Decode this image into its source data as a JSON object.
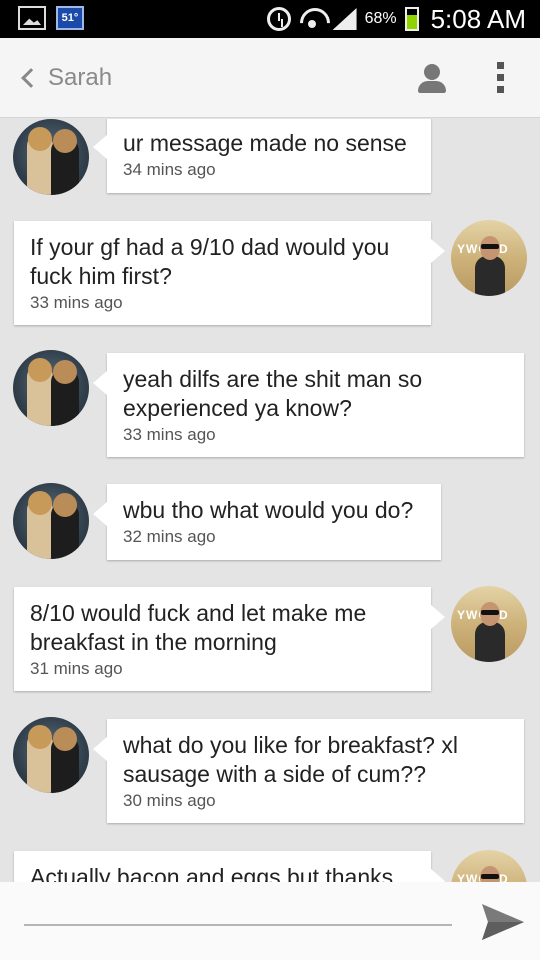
{
  "status_bar": {
    "temperature": "51°",
    "battery_percent": "68%",
    "battery_level": 0.68,
    "battery_color": "#8fd400",
    "time": "5:08 AM",
    "icons": [
      "gallery-icon",
      "weather-icon",
      "alarm-icon",
      "wifi-icon",
      "signal-icon",
      "battery-icon"
    ]
  },
  "header": {
    "title": "Sarah",
    "icons": [
      "chevron-left-icon",
      "profile-icon",
      "overflow-menu-icon"
    ]
  },
  "messages": [
    {
      "sender": "Sarah",
      "text": "ur message made no sense",
      "time": "34 mins ago"
    },
    {
      "sender": "me",
      "text": "If your gf had a 9/10 dad would you fuck him first?",
      "time": "33 mins ago"
    },
    {
      "sender": "Sarah",
      "text": "yeah dilfs are the shit man so experienced ya know?",
      "time": "33 mins ago"
    },
    {
      "sender": "Sarah",
      "text": "wbu tho what would you do?",
      "time": "32 mins ago"
    },
    {
      "sender": "me",
      "text": "8/10 would fuck and let make me breakfast in the morning",
      "time": "31 mins ago"
    },
    {
      "sender": "Sarah",
      "text": "what do you like for breakfast? xl sausage with a side of cum??",
      "time": "30 mins ago"
    },
    {
      "sender": "me",
      "text": "Actually bacon and eggs but thanks",
      "time": ""
    }
  ],
  "input": {
    "value": "",
    "placeholder": "",
    "send_icon": "send-icon"
  },
  "colors": {
    "background": "#e4e4e4",
    "bubble": "#ffffff",
    "header": "#f5f5f5",
    "status_bar": "#000000"
  }
}
